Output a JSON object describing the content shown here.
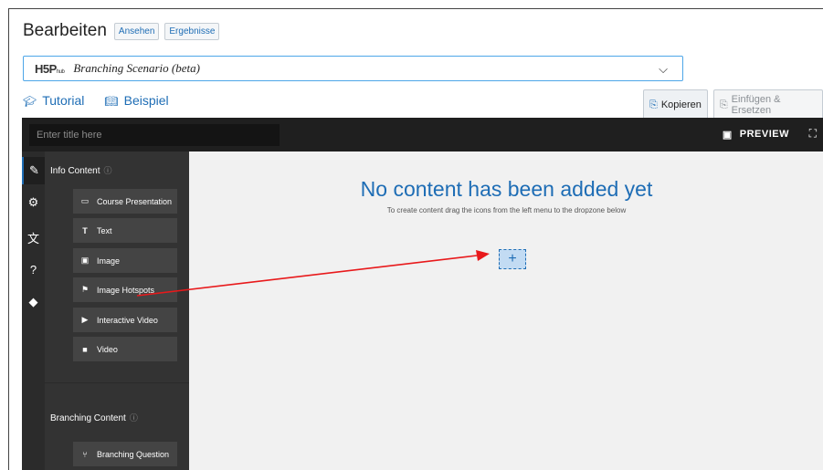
{
  "header": {
    "title": "Bearbeiten",
    "tabs": [
      "Ansehen",
      "Ergebnisse"
    ]
  },
  "content_type": {
    "logo": "H5P",
    "logo_sub": "hub",
    "selected": "Branching Scenario (beta)"
  },
  "links": {
    "tutorial": "Tutorial",
    "example": "Beispiel"
  },
  "clipboard": {
    "copy": "Kopieren",
    "paste": "Einfügen & Ersetzen"
  },
  "editor": {
    "title_placeholder": "Enter title here",
    "preview_label": "PREVIEW",
    "info_section": "Info Content",
    "branching_section": "Branching Content",
    "info_items": [
      "Course Presentation",
      "Text",
      "Image",
      "Image Hotspots",
      "Interactive Video",
      "Video"
    ],
    "branching_items": [
      "Branching Question"
    ],
    "empty_title": "No content has been added yet",
    "empty_subtitle": "To create content drag the icons from the left menu to the dropzone below",
    "dropzone_symbol": "+"
  },
  "colors": {
    "accent": "#1e6db5",
    "annotation_arrow": "#e8191b",
    "editor_dark": "#1f1f1f"
  }
}
